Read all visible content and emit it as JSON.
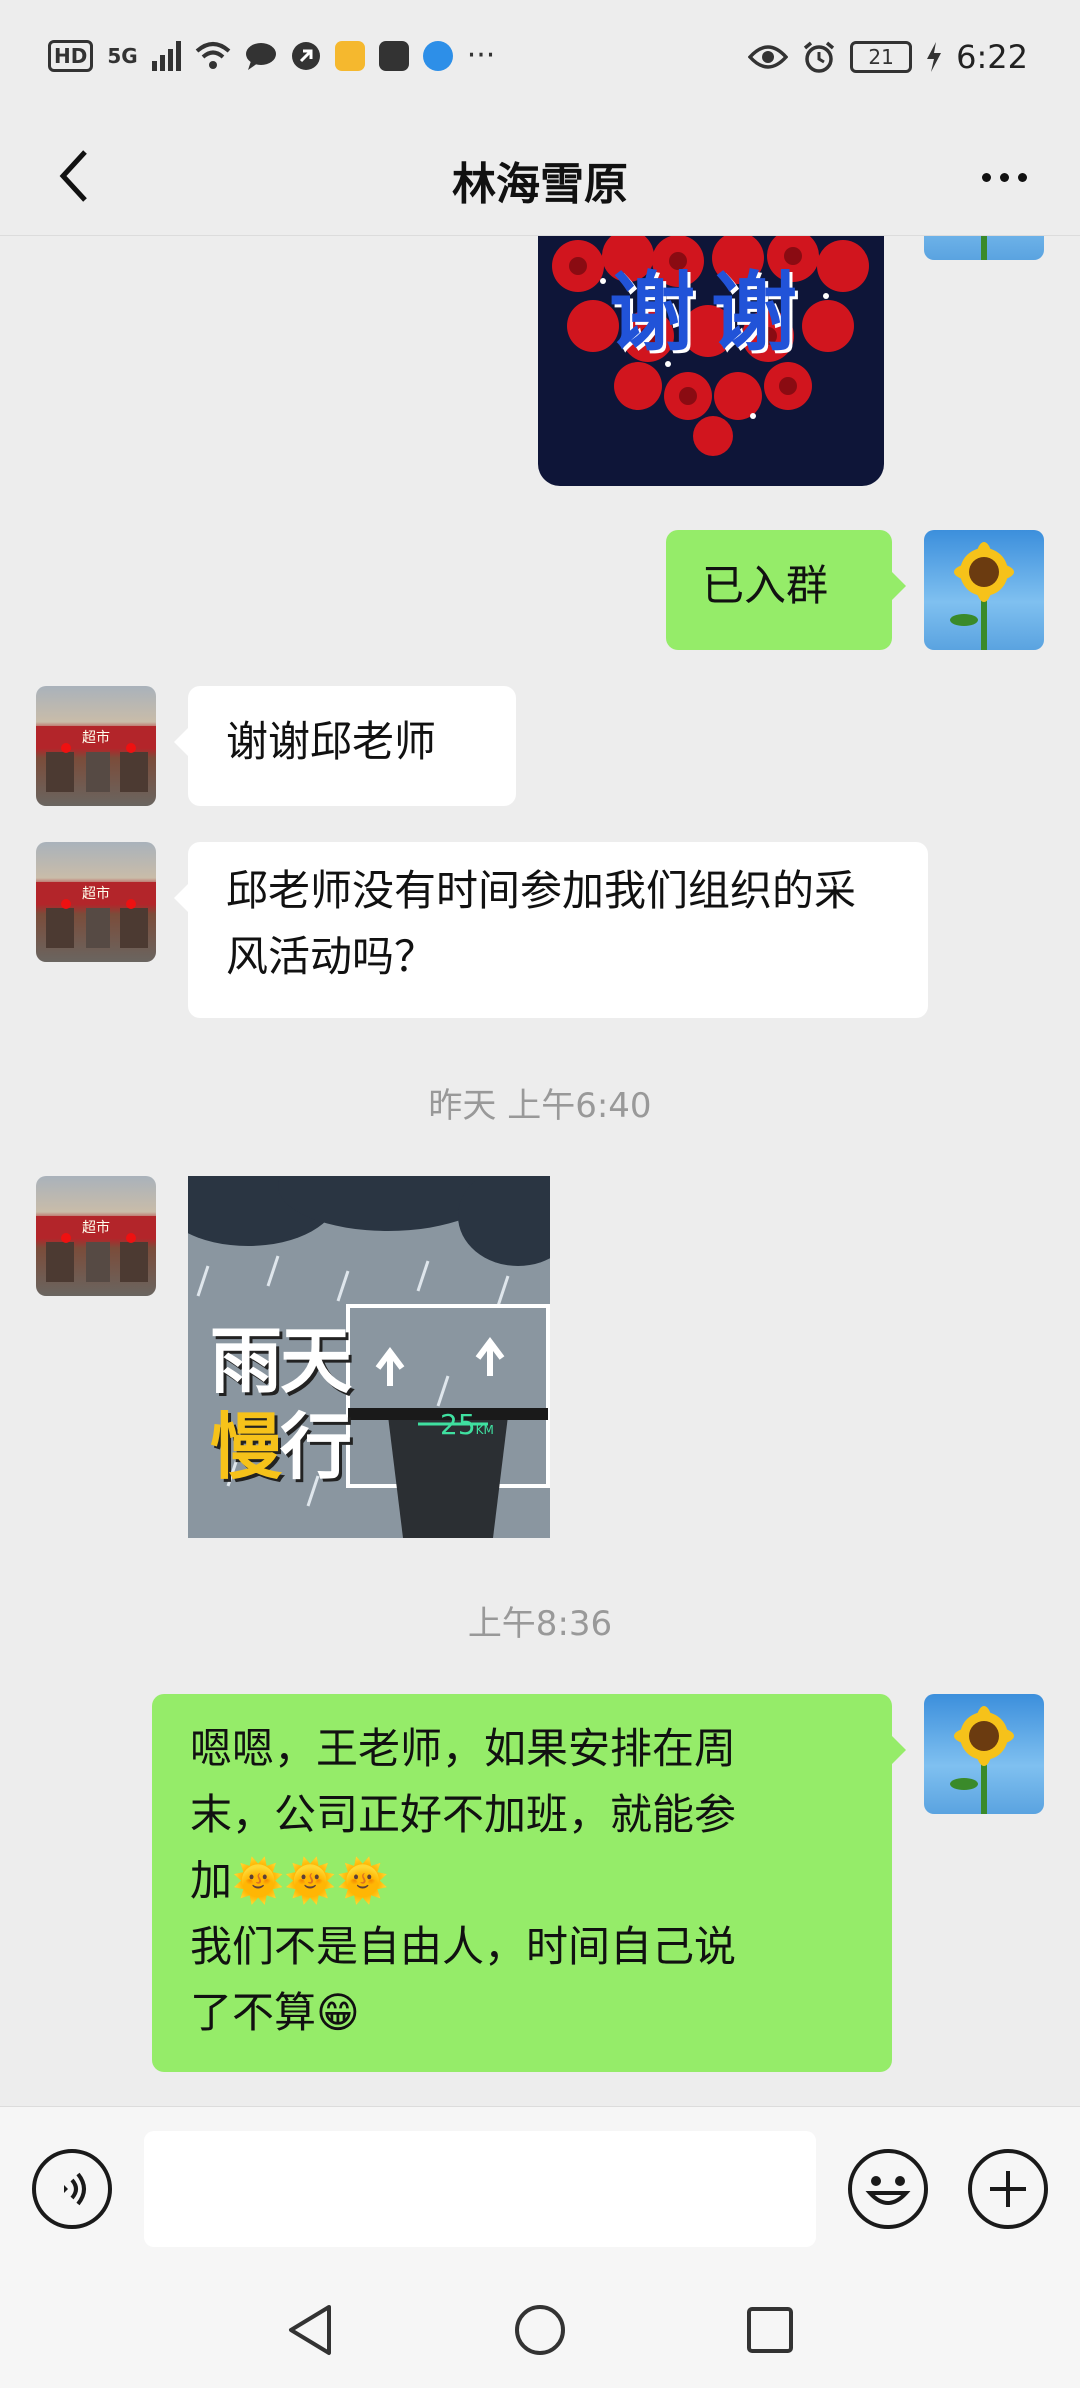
{
  "status_bar": {
    "hd": "HD",
    "signal": "5G",
    "more": "···",
    "battery": "21",
    "time": "6:22"
  },
  "header": {
    "title": "林海雪原"
  },
  "messages": {
    "sticker_thanks_text": "谢谢",
    "out_joined": "已入群",
    "in_thanks": "谢谢邱老师",
    "in_question": "邱老师没有时间参加我们组织的采风活动吗？",
    "timestamp_1": "昨天 上午6:40",
    "sticker_rain_line1": "雨天",
    "sticker_rain_line2a": "慢",
    "sticker_rain_line2b": "行",
    "sticker_rain_speed": "25",
    "sticker_rain_unit": "KM",
    "timestamp_2": "上午8:36",
    "out_reply_line1": "嗯嗯，王老师，如果安排在周",
    "out_reply_line2": "末，公司正好不加班，就能参",
    "out_reply_line3": "加🌞🌞🌞",
    "out_reply_line4": "我们不是自由人，时间自己说",
    "out_reply_line5": "了不算😁"
  },
  "input": {
    "placeholder": ""
  },
  "colors": {
    "background": "#ededed",
    "outgoing_bubble": "#95ec69",
    "incoming_bubble": "#ffffff",
    "timestamp": "#999999"
  },
  "icons": {
    "back": "chevron-left-icon",
    "more": "more-dots-icon",
    "voice": "voice-icon",
    "emoji": "smiley-icon",
    "plus": "plus-icon",
    "nav_back": "triangle-back-icon",
    "nav_home": "circle-home-icon",
    "nav_recent": "square-recents-icon"
  }
}
